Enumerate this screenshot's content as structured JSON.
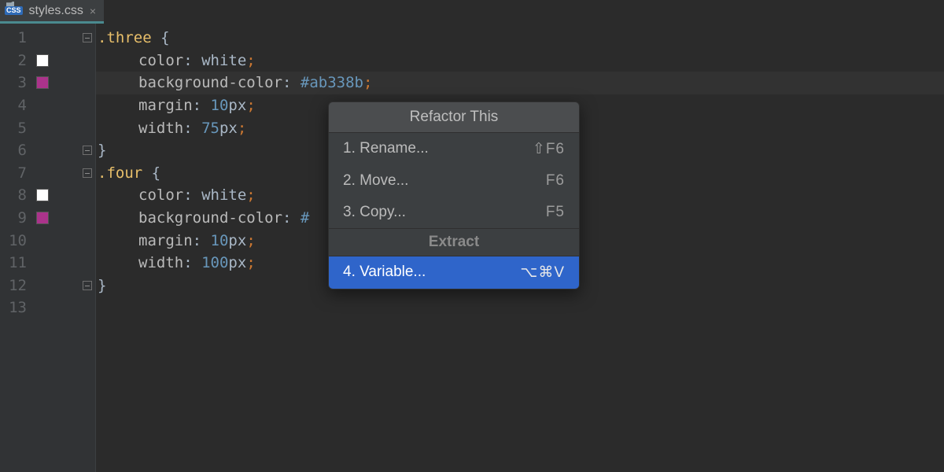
{
  "tab": {
    "filename": "styles.css",
    "badge": "CSS",
    "close_glyph": "×"
  },
  "lines": [
    "1",
    "2",
    "3",
    "4",
    "5",
    "6",
    "7",
    "8",
    "9",
    "10",
    "11",
    "12",
    "13"
  ],
  "gutter_swatches": {
    "2": "white",
    "3": "magenta",
    "8": "white",
    "9": "magenta"
  },
  "code": {
    "l1": {
      "sel": ".three",
      "brace": " {"
    },
    "l2": {
      "prop": "color",
      "colon": ": ",
      "val": "white",
      "semi": ";"
    },
    "l3": {
      "prop": "background-color",
      "colon": ": ",
      "val": "#ab338b",
      "semi": ";"
    },
    "l4": {
      "prop": "margin",
      "colon": ": ",
      "num": "10",
      "unit": "px",
      "semi": ";"
    },
    "l5": {
      "prop": "width",
      "colon": ": ",
      "num": "75",
      "unit": "px",
      "semi": ";"
    },
    "l6": {
      "brace": "}"
    },
    "l7": {
      "sel": ".four",
      "brace": " {"
    },
    "l8": {
      "prop": "color",
      "colon": ": ",
      "val": "white",
      "semi": ";"
    },
    "l9": {
      "prop": "background-color",
      "colon": ": ",
      "val": "#"
    },
    "l10": {
      "prop": "margin",
      "colon": ": ",
      "num": "10",
      "unit": "px",
      "semi": ";"
    },
    "l11": {
      "prop": "width",
      "colon": ": ",
      "num": "100",
      "unit": "px",
      "semi": ";"
    },
    "l12": {
      "brace": "}"
    }
  },
  "popup": {
    "title": "Refactor This",
    "items": [
      {
        "label": "1. Rename...",
        "shortcut": "⇧F6"
      },
      {
        "label": "2. Move...",
        "shortcut": "F6"
      },
      {
        "label": "3. Copy...",
        "shortcut": "F5"
      }
    ],
    "section": "Extract",
    "selected": {
      "label": "4. Variable...",
      "shortcut": "⌥⌘V"
    }
  },
  "colors": {
    "accent": "#2f65ca",
    "magenta_swatch": "#ab338b"
  }
}
